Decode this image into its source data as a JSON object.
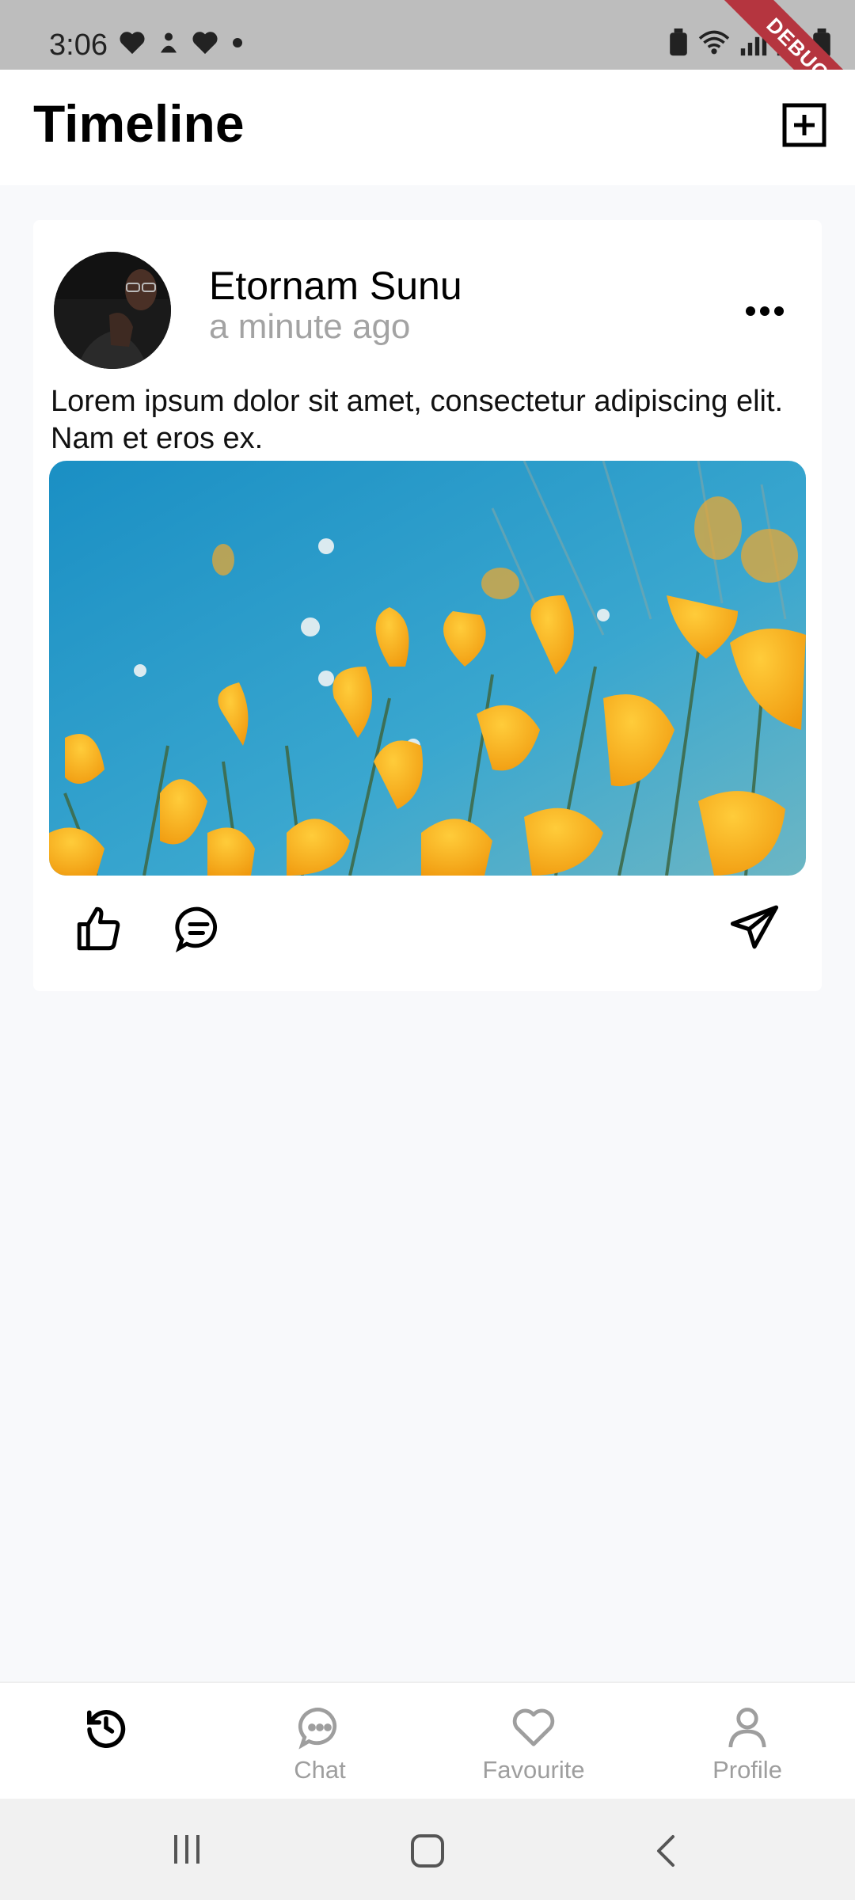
{
  "status_bar": {
    "time": "3:06",
    "debug_label": "DEBUG"
  },
  "app_bar": {
    "title": "Timeline",
    "add_icon": "add-box-icon"
  },
  "post": {
    "author": "Etornam Sunu",
    "time_ago": "a minute ago",
    "text": "Lorem ipsum dolor sit amet, consectetur adipiscing elit. Nam et eros ex.",
    "image": "orange-poppies-against-blue-sky",
    "actions": [
      "thumbs-up-icon",
      "comment-icon",
      "send-icon"
    ]
  },
  "bottom_nav": {
    "items": [
      {
        "label": "",
        "icon": "history-icon",
        "active": true
      },
      {
        "label": "Chat",
        "icon": "chat-bubble-icon",
        "active": false
      },
      {
        "label": "Favourite",
        "icon": "heart-icon",
        "active": false
      },
      {
        "label": "Profile",
        "icon": "person-icon",
        "active": false
      }
    ]
  },
  "colors": {
    "background": "#f8f9fb",
    "inactive_nav": "#9e9e9e",
    "debug_banner": "#b5353f"
  }
}
